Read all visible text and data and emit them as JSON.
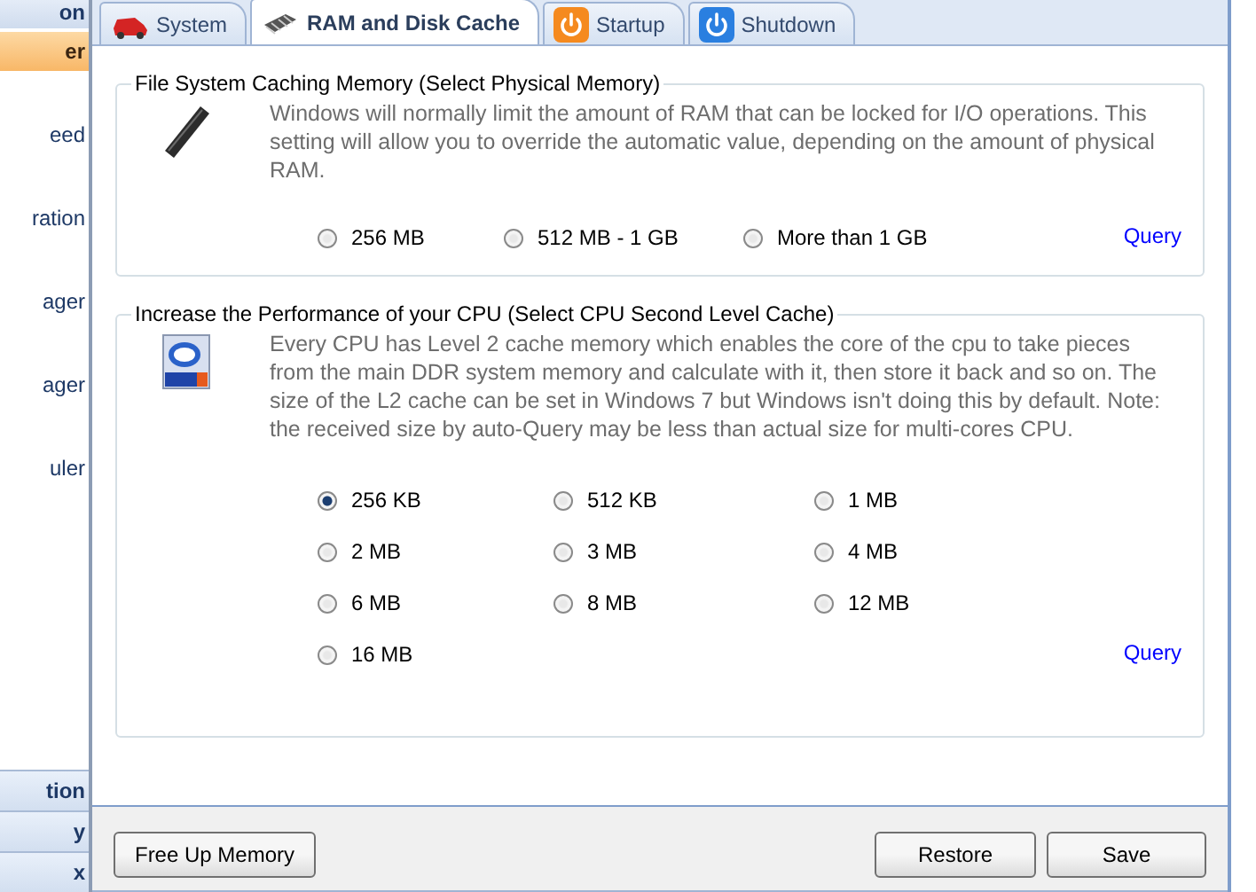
{
  "sidebar": {
    "header": "on",
    "items": [
      {
        "label": "er",
        "selected": true
      },
      {
        "label": "eed",
        "selected": false
      },
      {
        "label": "ration",
        "selected": false
      },
      {
        "label": "ager",
        "selected": false
      },
      {
        "label": "ager",
        "selected": false
      },
      {
        "label": "uler",
        "selected": false
      }
    ],
    "groups": [
      "tion",
      "y",
      "x"
    ]
  },
  "tabs": [
    {
      "label": "System",
      "selected": false
    },
    {
      "label": "RAM and Disk Cache",
      "selected": true
    },
    {
      "label": "Startup",
      "selected": false
    },
    {
      "label": "Shutdown",
      "selected": false
    }
  ],
  "sections": [
    {
      "title": "File System Caching Memory (Select Physical Memory)",
      "text": "Windows will normally limit the amount of RAM that can be locked for I/O operations. This setting will allow you to override the automatic value, depending on the amount of physical RAM.",
      "options": [
        {
          "label": "256 MB",
          "selected": false
        },
        {
          "label": "512 MB - 1 GB",
          "selected": false
        },
        {
          "label": "More than 1 GB",
          "selected": false
        }
      ],
      "query": "Query"
    },
    {
      "title": "Increase the Performance of your CPU (Select CPU Second Level Cache)",
      "text": "Every CPU has Level 2 cache memory which enables the core of the cpu to take pieces from the main DDR system memory and calculate with it, then store it back and so on. The size of the L2 cache can be set in Windows 7 but Windows isn't doing this by default. Note: the received size by auto-Query may be less than actual size for multi-cores CPU.",
      "options": [
        {
          "label": "256 KB",
          "selected": true
        },
        {
          "label": "512 KB",
          "selected": false
        },
        {
          "label": "1 MB",
          "selected": false
        },
        {
          "label": "2 MB",
          "selected": false
        },
        {
          "label": "3 MB",
          "selected": false
        },
        {
          "label": "4 MB",
          "selected": false
        },
        {
          "label": "6 MB",
          "selected": false
        },
        {
          "label": "8 MB",
          "selected": false
        },
        {
          "label": "12 MB",
          "selected": false
        },
        {
          "label": "16 MB",
          "selected": false
        }
      ],
      "query": "Query"
    }
  ],
  "buttons": {
    "left": [
      "Free Up Memory"
    ],
    "right": [
      "Restore",
      "Save"
    ]
  }
}
